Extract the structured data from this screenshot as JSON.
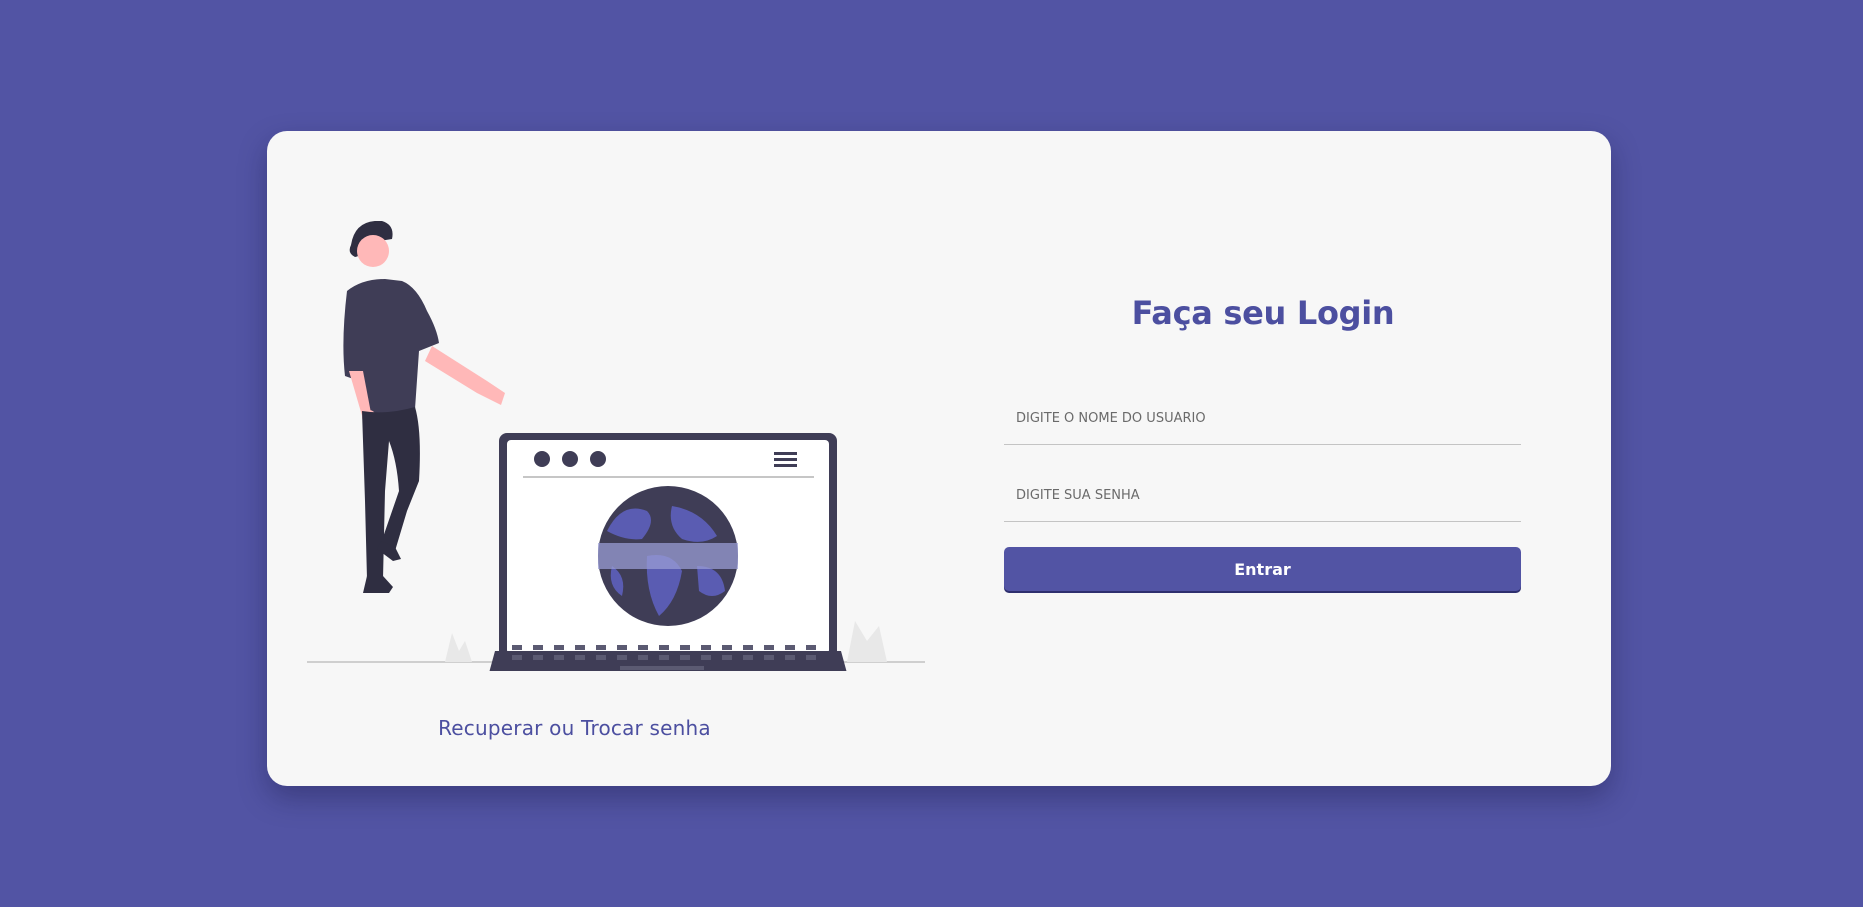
{
  "login": {
    "title": "Faça seu Login",
    "username_placeholder": "DIGITE O NOME DO USUÁRIO",
    "password_placeholder": "DIGITE SUA SENHA",
    "submit_label": "Entrar",
    "recover_link": "Recuperar ou Trocar senha"
  },
  "illustration": {
    "icon": "person-laptop-globe-illustration"
  },
  "colors": {
    "background": "#5254a4",
    "card": "#f7f7f7",
    "accent": "#4c4fa0",
    "dark": "#3f3d56",
    "skin": "#ffb8b8"
  }
}
